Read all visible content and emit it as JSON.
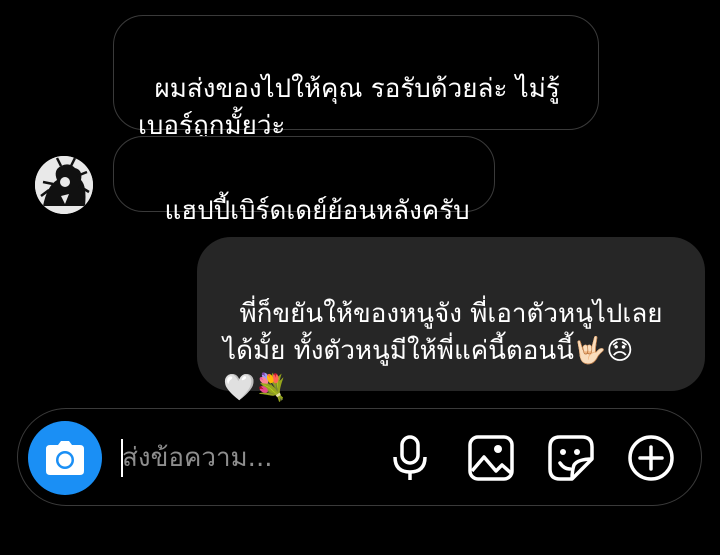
{
  "messages": [
    {
      "id": "msg1",
      "direction": "received",
      "text": "ผมส่งของไปให้คุณ รอรับด้วยล่ะ ไม่รู้\nเบอร์ถูกมั้ยว่ะ"
    },
    {
      "id": "msg2",
      "direction": "received",
      "text": "แฮปปี้เบิร์ดเดย์ย้อนหลังครับ"
    },
    {
      "id": "msg3",
      "direction": "sent",
      "text": "พี่ก็ขยันให้ของหนูจัง พี่เอาตัวหนูไปเลย\nได้มั้ย ทั้งตัวหนูมีให้พี่แค่นี้ตอนนี้",
      "emojis_line2": [
        "🤟🏻",
        "😞"
      ],
      "emojis_line3": [
        "🤍",
        "💐"
      ]
    }
  ],
  "composer": {
    "placeholder": "ส่งข้อความ...",
    "value": "",
    "icons": [
      "camera-icon",
      "microphone-icon",
      "image-icon",
      "sticker-icon",
      "plus-circle-icon"
    ],
    "camera_button_color": "#1a8ff5"
  },
  "colors": {
    "background": "#000000",
    "sent_bubble": "#262626",
    "received_border": "#3a3a3a",
    "text": "#ffffff",
    "placeholder": "#8e8e8e"
  }
}
